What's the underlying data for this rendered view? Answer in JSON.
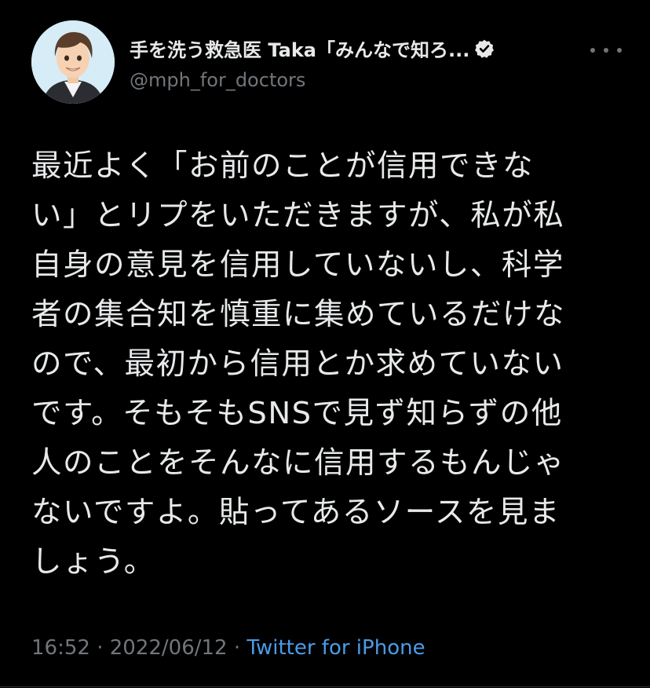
{
  "tweet": {
    "author": {
      "display_name": "手を洗う救急医 Taka「みんなで知ろ...",
      "handle": "@mph_for_doctors",
      "verified_icon": "verified-badge-icon"
    },
    "more_icon": "more-horizontal-icon",
    "body_lines": [
      "最近よく「お前のことが信用できな",
      "い」とリプをいただきますが、私が私",
      "自身の意見を信用していないし、科学",
      "者の集合知を慎重に集めているだけな",
      "ので、最初から信用とか求めていない",
      "です。そもそもSNSで見ず知らずの他",
      "人のことをそんなに信用するもんじゃ",
      "ないですよ。貼ってあるソースを見ま",
      "しょう。"
    ],
    "time": "16:52",
    "separator": "·",
    "date": "2022/06/12",
    "source": "Twitter for iPhone"
  },
  "colors": {
    "background": "#000000",
    "text": "#e7e9ea",
    "muted": "#71767b",
    "link": "#4a9ce8"
  }
}
